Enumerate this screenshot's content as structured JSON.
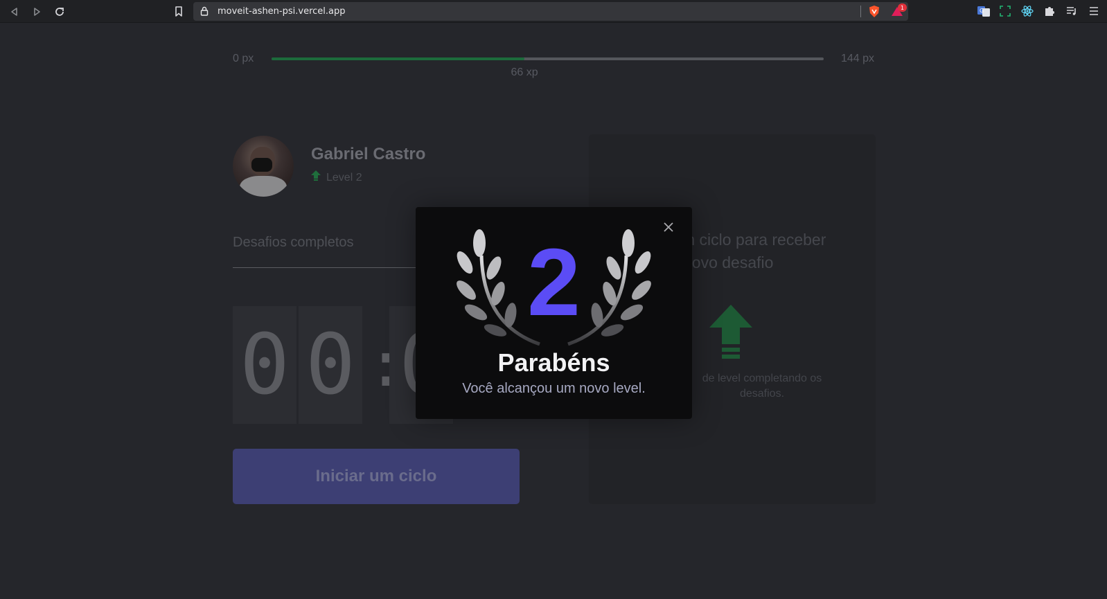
{
  "browser": {
    "url": "moveit-ashen-psi.vercel.app",
    "badge_count": "1"
  },
  "experience": {
    "min_label": "0 px",
    "max_label": "144 px",
    "current_label": "66 xp",
    "progress": 0.458,
    "fill_color": "#1c6b3b"
  },
  "profile": {
    "name": "Gabriel Castro",
    "level_label": "Level 2"
  },
  "challenges": {
    "label": "Desafios completos"
  },
  "countdown": {
    "digits": [
      "0",
      "0",
      "0"
    ],
    "separator": ":"
  },
  "start_button": {
    "label": "Iniciar um ciclo"
  },
  "challenge_card": {
    "title_line1": "m ciclo para receber",
    "title_line2": "novo desafio",
    "description_line1": "de level completando os",
    "description_line2": "desafios."
  },
  "modal": {
    "level": "2",
    "title": "Parabéns",
    "subtitle": "Você alcançou um novo level.",
    "accent": "#5b4cf5"
  },
  "icons": {
    "back": "back-arrow-icon",
    "forward": "forward-arrow-icon",
    "reload": "reload-icon",
    "bookmark": "bookmark-icon",
    "lock": "lock-icon",
    "close": "close-icon",
    "level_up": "level-up-icon",
    "laurel": "laurel-icon"
  }
}
